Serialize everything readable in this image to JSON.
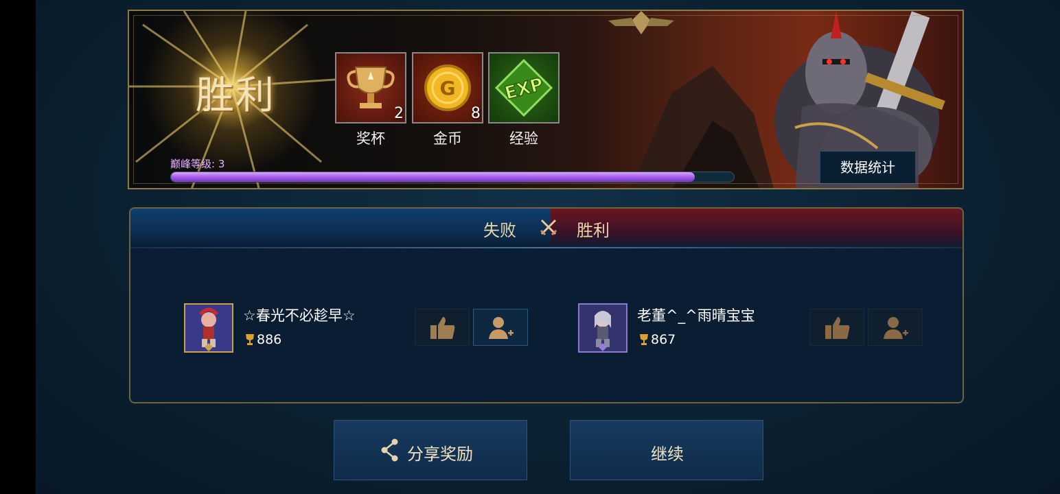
{
  "banner": {
    "title": "胜利",
    "rewards": [
      {
        "icon": "trophy-icon",
        "count": "2",
        "label": "奖杯"
      },
      {
        "icon": "gold-coin-icon",
        "count": "8",
        "label": "金币"
      },
      {
        "icon": "exp-icon",
        "count": "",
        "label": "经验"
      }
    ],
    "peak_level_label": "巅峰等级: 3",
    "peak_progress_fraction": 0.93,
    "stats_button_label": "数据统计"
  },
  "result": {
    "left_team_result": "失败",
    "right_team_result": "胜利",
    "players": [
      {
        "name": "☆春光不必趁早☆",
        "trophies": "886"
      },
      {
        "name": "老董^_^雨晴宝宝",
        "trophies": "867"
      }
    ]
  },
  "buttons": {
    "share_label": "分享奖励",
    "continue_label": "继续"
  },
  "colors": {
    "gold_border": "#8e7a45",
    "progress_purple": "#a45de8",
    "defeat_blue": "#0f3f6e",
    "victory_red": "#6b1520"
  }
}
